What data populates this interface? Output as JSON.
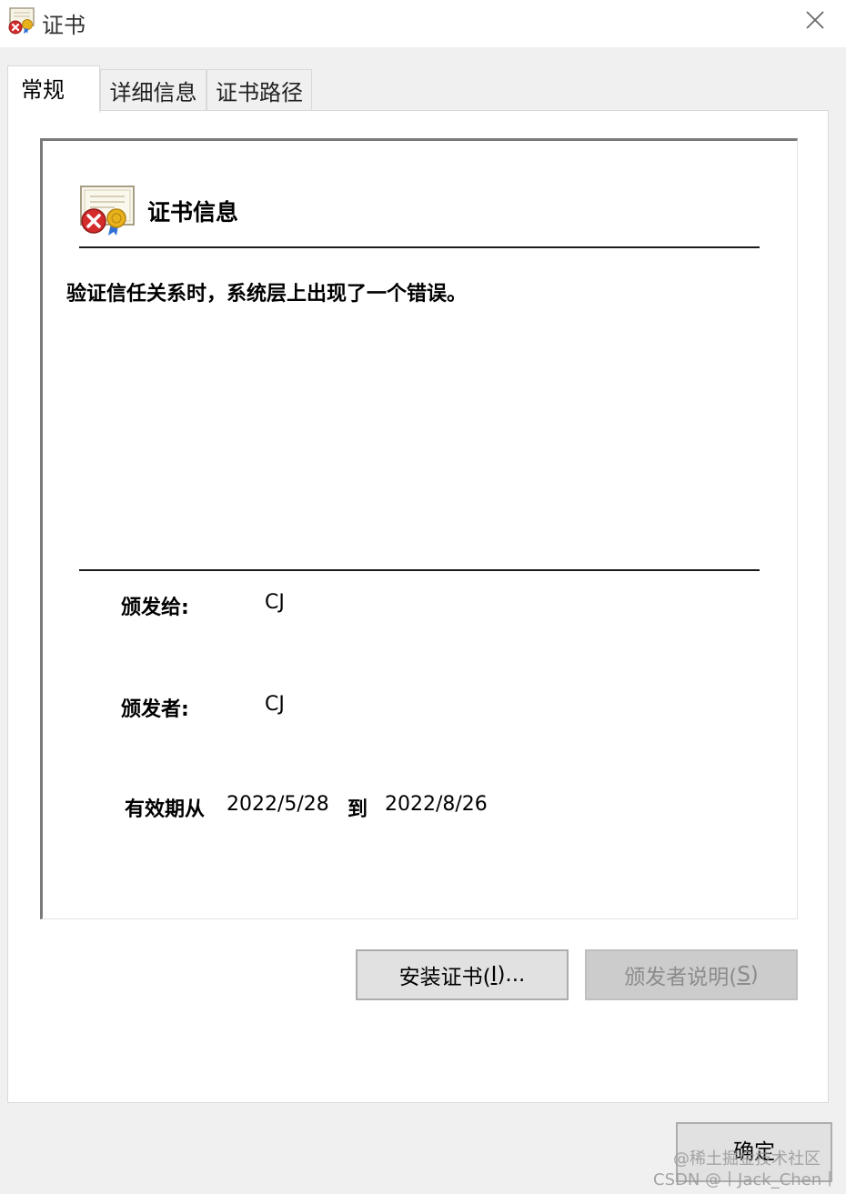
{
  "window": {
    "title": "证书",
    "title_icon": "certificate-error-icon",
    "close_icon": "close-icon"
  },
  "tabs": [
    {
      "label": "常规",
      "active": true
    },
    {
      "label": "详细信息",
      "active": false
    },
    {
      "label": "证书路径",
      "active": false
    }
  ],
  "general": {
    "heading": "证书信息",
    "heading_icon": "certificate-error-icon",
    "error_message": "验证信任关系时，系统层上出现了一个错误。",
    "issued_to_label": "颁发给:",
    "issued_to_value": "CJ",
    "issued_by_label": "颁发者:",
    "issued_by_value": "CJ",
    "validity_from_label": "有效期从",
    "valid_from": "2022/5/28",
    "validity_to_label": "到",
    "valid_to": "2022/8/26"
  },
  "buttons": {
    "install": {
      "label_before": "安装证书(",
      "mnemonic": "I",
      "label_after": ")...",
      "enabled": true
    },
    "issuer_statement": {
      "label_before": "颁发者说明(",
      "mnemonic": "S",
      "label_after": ")",
      "enabled": false
    },
    "ok": "确定"
  },
  "watermark": {
    "line1": "@稀土掘金技术社区",
    "line2": "CSDN @丨Jack_Chen丨"
  },
  "colors": {
    "error_red": "#d42b2b",
    "seal_gold": "#e8b21c",
    "ribbon_blue": "#2f6fd6",
    "dialog_bg": "#f0f0f0",
    "disabled_text": "#8c8c8c"
  }
}
